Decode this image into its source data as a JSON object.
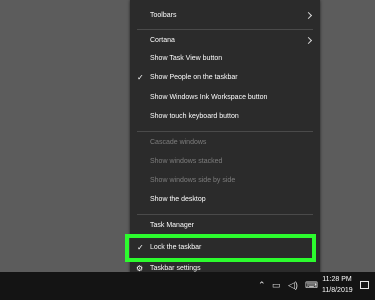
{
  "menu": {
    "items": [
      {
        "label": "Toolbars",
        "submenu": true,
        "enabled": true,
        "checked": false
      },
      {
        "label": "Cortana",
        "submenu": true,
        "enabled": true,
        "checked": false
      },
      {
        "label": "Show Task View button",
        "enabled": true,
        "checked": false
      },
      {
        "label": "Show People on the taskbar",
        "enabled": true,
        "checked": true
      },
      {
        "label": "Show Windows Ink Workspace button",
        "enabled": true,
        "checked": false
      },
      {
        "label": "Show touch keyboard button",
        "enabled": true,
        "checked": false
      },
      {
        "label": "Cascade windows",
        "enabled": false,
        "checked": false
      },
      {
        "label": "Show windows stacked",
        "enabled": false,
        "checked": false
      },
      {
        "label": "Show windows side by side",
        "enabled": false,
        "checked": false
      },
      {
        "label": "Show the desktop",
        "enabled": true,
        "checked": false
      },
      {
        "label": "Task Manager",
        "enabled": true,
        "checked": false
      },
      {
        "label": "Lock the taskbar",
        "enabled": true,
        "checked": true,
        "highlighted": true
      },
      {
        "label": "Taskbar settings",
        "enabled": true,
        "checked": false,
        "icon": "gear-icon"
      }
    ],
    "check_glyph": "✓"
  },
  "highlight_color": "#2cfc2e",
  "taskbar": {
    "time": "11:28 PM",
    "date": "11/8/2019"
  }
}
